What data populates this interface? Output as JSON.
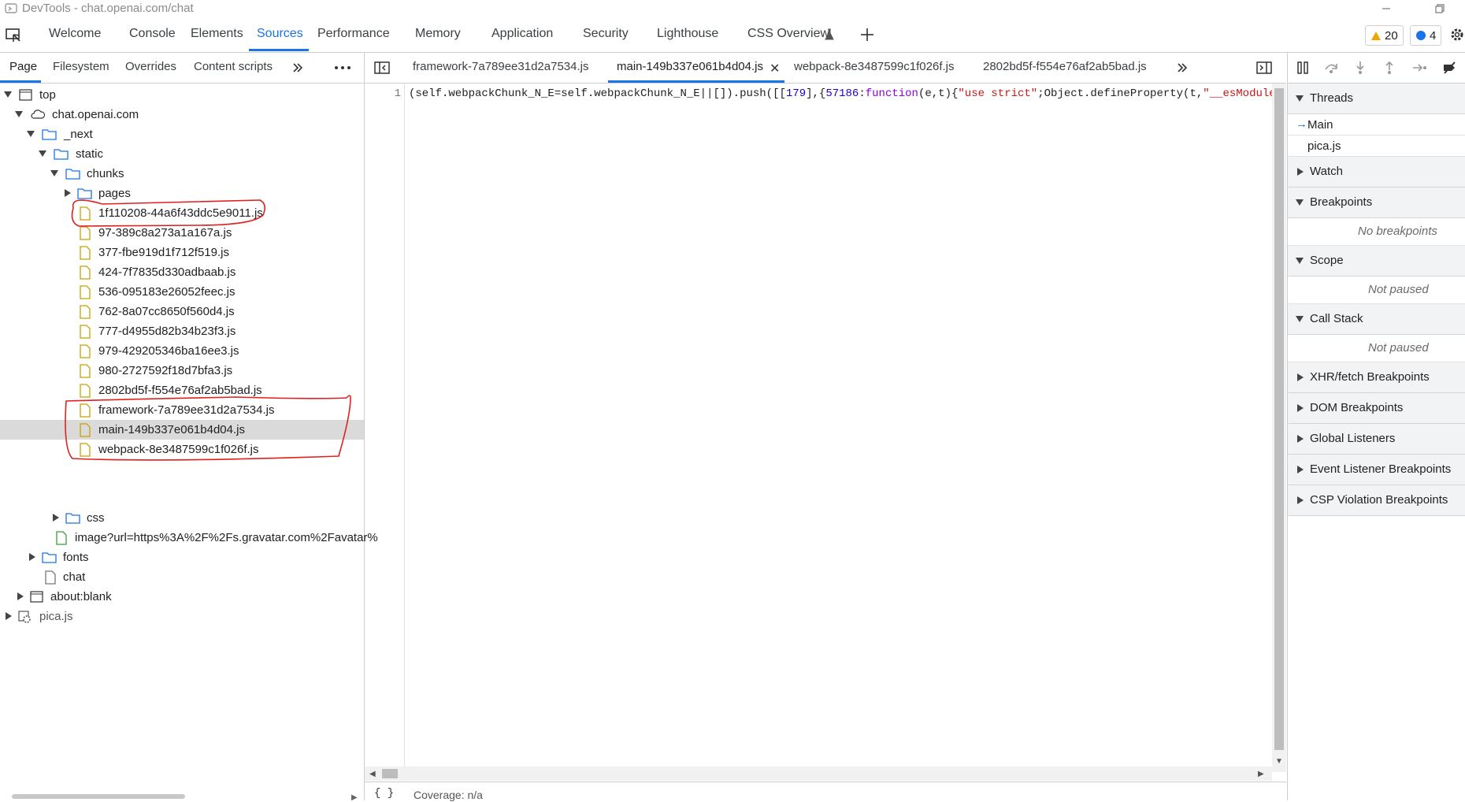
{
  "window": {
    "title": "DevTools - chat.openai.com/chat"
  },
  "main_tabs": {
    "items": [
      "Welcome",
      "Console",
      "Elements",
      "Sources",
      "Performance",
      "Memory",
      "Application",
      "Security",
      "Lighthouse",
      "CSS Overview"
    ],
    "active": "Sources",
    "warnings_count": "20",
    "messages_count": "4"
  },
  "navigator": {
    "tabs": [
      "Page",
      "Filesystem",
      "Overrides",
      "Content scripts"
    ],
    "active": "Page",
    "tree": [
      "top",
      "chat.openai.com",
      "_next",
      "static",
      "chunks",
      "pages",
      "1f110208-44a6f43ddc5e9011.js",
      "97-389c8a273a1a167a.js",
      "377-fbe919d1f712f519.js",
      "424-7f7835d330adbaab.js",
      "536-095183e26052feec.js",
      "762-8a07cc8650f560d4.js",
      "777-d4955d82b34b23f3.js",
      "979-429205346ba16ee3.js",
      "980-2727592f18d7bfa3.js",
      "2802bd5f-f554e76af2ab5bad.js",
      "framework-7a789ee31d2a7534.js",
      "main-149b337e061b4d04.js",
      "webpack-8e3487599c1f026f.js",
      "css",
      "image?url=https%3A%2F%2Fs.gravatar.com%2Favatar%",
      "fonts",
      "chat",
      "about:blank",
      "pica.js"
    ]
  },
  "editor": {
    "tabs": [
      "framework-7a789ee31d2a7534.js",
      "main-149b337e061b4d04.js",
      "webpack-8e3487599c1f026f.js",
      "2802bd5f-f554e76af2ab5bad.js"
    ],
    "active_tab": "main-149b337e061b4d04.js",
    "line_number": "1",
    "code": {
      "p1": "(self.webpackChunk_N_E=self.webpackChunk_N_E||[]).push([[",
      "n1": "179",
      "p2": "],{",
      "n2": "57186",
      "p3": ":",
      "kw": "function",
      "p4": "(e,t){",
      "s1": "\"use strict\"",
      "p5": ";Object.defineProperty(t,",
      "s2": "\"__esModule\"",
      "p6": ","
    },
    "footer_braces": "{ }",
    "coverage": "Coverage: n/a"
  },
  "debugger": {
    "threads_label": "Threads",
    "threads": [
      "Main",
      "pica.js"
    ],
    "watch_label": "Watch",
    "breakpoints_label": "Breakpoints",
    "no_breakpoints": "No breakpoints",
    "scope_label": "Scope",
    "scope_note": "Not paused",
    "callstack_label": "Call Stack",
    "callstack_note": "Not paused",
    "xhr_label": "XHR/fetch Breakpoints",
    "dom_label": "DOM Breakpoints",
    "global_label": "Global Listeners",
    "event_label": "Event Listener Breakpoints",
    "csp_label": "CSP Violation Breakpoints"
  },
  "colors": {
    "accent": "#1a73e8",
    "annotation": "#e02020",
    "file_icon": "#c8a200"
  }
}
